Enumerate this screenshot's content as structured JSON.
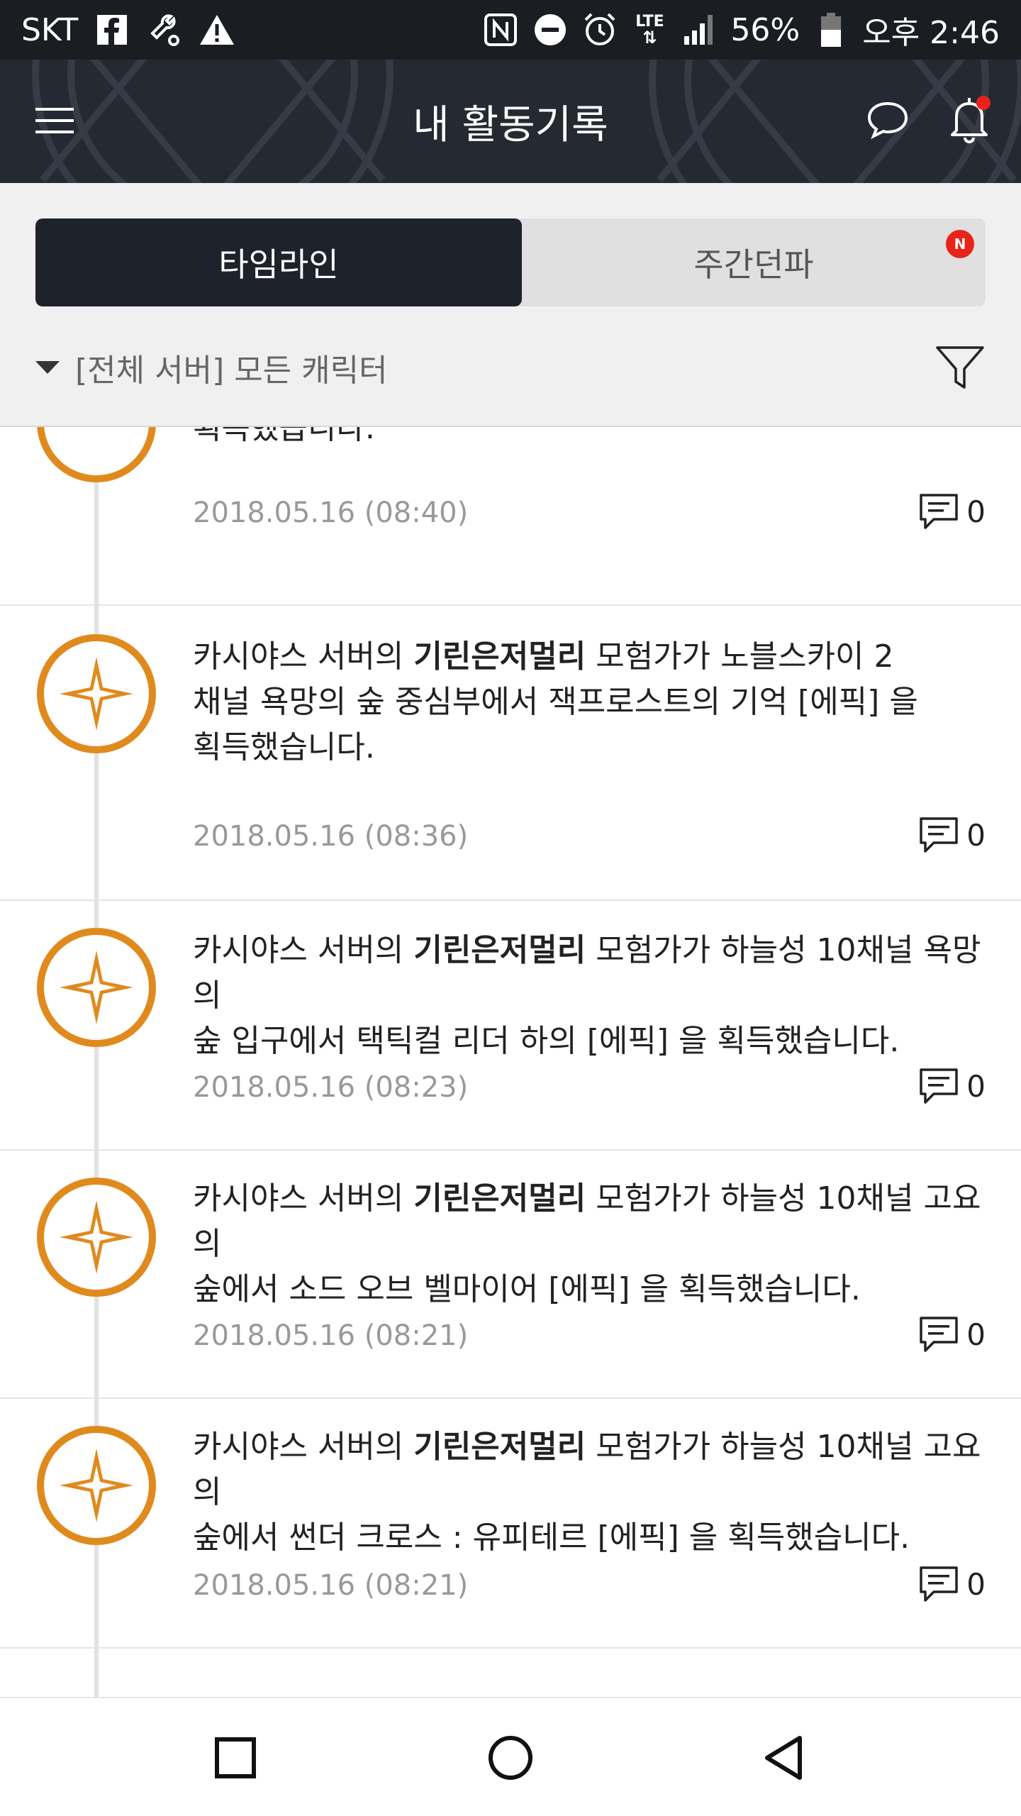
{
  "status_bar": {
    "carrier": "SKT",
    "left_icons": [
      "facebook-icon",
      "wrench-icon",
      "warning-icon"
    ],
    "right_icons": [
      "nfc-icon",
      "do-not-disturb-icon",
      "alarm-icon",
      "lte-icon",
      "signal-icon"
    ],
    "lte_label": "LTE",
    "battery": "56%",
    "time": "오후 2:46"
  },
  "header": {
    "title": "내 활동기록",
    "menu_icon": "hamburger-menu-icon",
    "chat_icon": "chat-bubble-icon",
    "bell_icon": "notification-bell-icon",
    "bell_dot_color": "#e8231a",
    "background_color": "#252932"
  },
  "tabs": [
    {
      "label": "타임라인",
      "active": true
    },
    {
      "label": "주간던파",
      "active": false,
      "badge": "N"
    }
  ],
  "filter": {
    "label": "[전체 서버] 모든 캐릭터",
    "icon": "filter-funnel-icon"
  },
  "accent_color": "#e08a1e",
  "timeline": [
    {
      "text_tail": "획득했습니다.",
      "date": "2018.05.16 (08:40)",
      "comments": "0"
    },
    {
      "prefix": "카시야스 서버의 ",
      "name": "기린은저멀리",
      "line1_rest": " 모험가가 노블스카이 2",
      "line2": "채널 욕망의 숲 중심부에서 잭프로스트의 기억 [에픽] 을",
      "line3": "획득했습니다.",
      "date": "2018.05.16 (08:36)",
      "comments": "0"
    },
    {
      "prefix": "카시야스 서버의 ",
      "name": "기린은저멀리",
      "line1_rest": " 모험가가 하늘성 10채널 욕망의",
      "line2": "숲 입구에서 택틱컬 리더 하의 [에픽] 을 획득했습니다.",
      "date": "2018.05.16 (08:23)",
      "comments": "0"
    },
    {
      "prefix": "카시야스 서버의 ",
      "name": "기린은저멀리",
      "line1_rest": " 모험가가 하늘성 10채널 고요의",
      "line2": "숲에서 소드 오브 벨마이어 [에픽] 을 획득했습니다.",
      "date": "2018.05.16 (08:21)",
      "comments": "0"
    },
    {
      "prefix": "카시야스 서버의 ",
      "name": "기린은저멀리",
      "line1_rest": " 모험가가 하늘성 10채널 고요의",
      "line2": "숲에서 썬더 크로스 : 유피테르 [에픽] 을 획득했습니다.",
      "date": "2018.05.16 (08:21)",
      "comments": "0"
    }
  ],
  "nav": {
    "icons": [
      "recent-apps-icon",
      "home-icon",
      "back-icon"
    ]
  }
}
